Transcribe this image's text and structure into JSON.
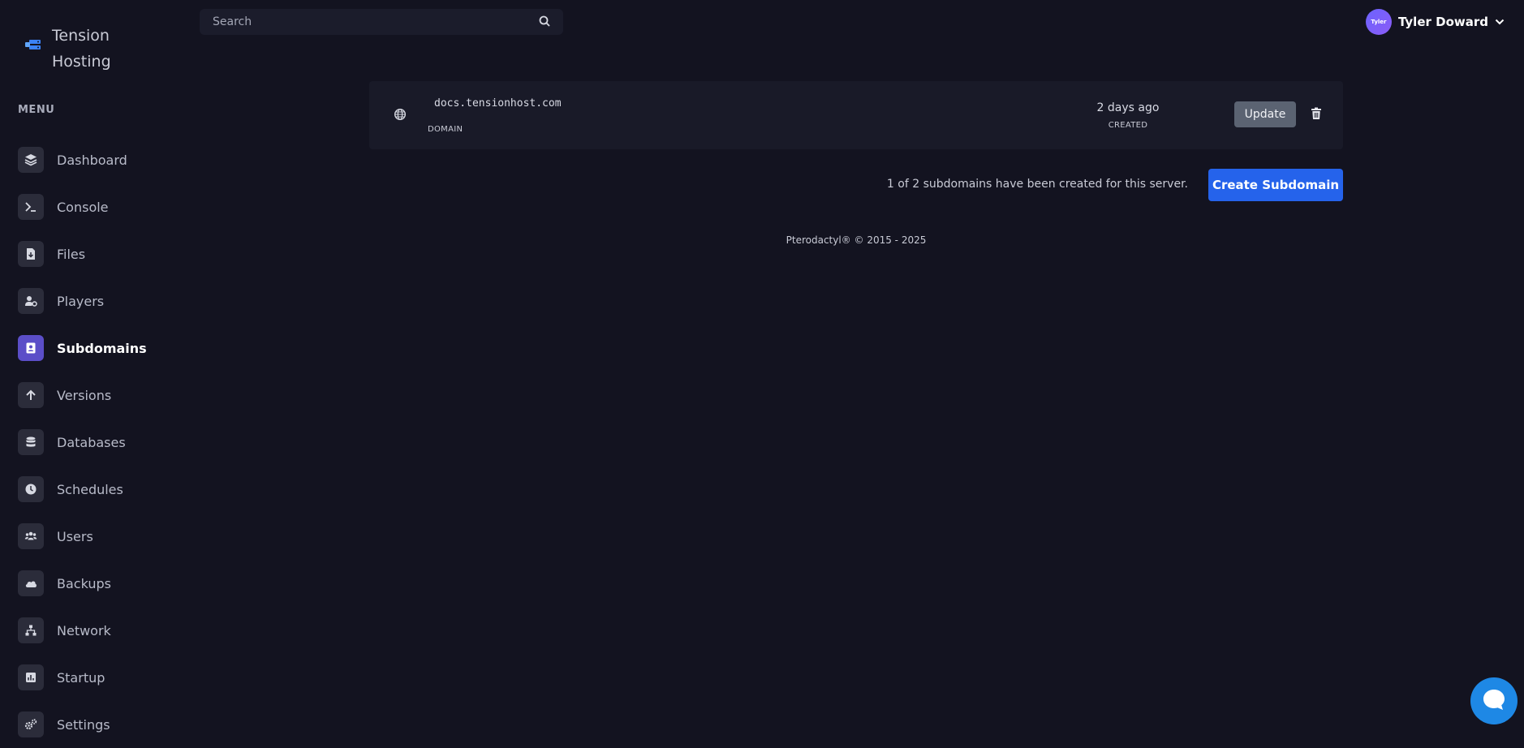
{
  "brand": {
    "name": "Tension Hosting"
  },
  "sidebar": {
    "menu_label": "MENU",
    "items": [
      {
        "label": "Dashboard",
        "icon": "layers-icon",
        "active": false
      },
      {
        "label": "Console",
        "icon": "terminal-icon",
        "active": false
      },
      {
        "label": "Files",
        "icon": "file-download-icon",
        "active": false
      },
      {
        "label": "Players",
        "icon": "user-gear-icon",
        "active": false
      },
      {
        "label": "Subdomains",
        "icon": "address-card-icon",
        "active": true
      },
      {
        "label": "Versions",
        "icon": "arrow-up-icon",
        "active": false
      },
      {
        "label": "Databases",
        "icon": "database-icon",
        "active": false
      },
      {
        "label": "Schedules",
        "icon": "clock-icon",
        "active": false
      },
      {
        "label": "Users",
        "icon": "users-icon",
        "active": false
      },
      {
        "label": "Backups",
        "icon": "cloud-icon",
        "active": false
      },
      {
        "label": "Network",
        "icon": "network-icon",
        "active": false
      },
      {
        "label": "Startup",
        "icon": "chart-icon",
        "active": false
      },
      {
        "label": "Settings",
        "icon": "cogs-icon",
        "active": false
      }
    ]
  },
  "search": {
    "placeholder": "Search"
  },
  "user": {
    "name": "Tyler Doward",
    "avatar_text": "Tyler"
  },
  "subdomains": [
    {
      "domain": "docs.tensionhost.com",
      "domain_label": "DOMAIN",
      "created": "2 days ago",
      "created_label": "CREATED",
      "update_label": "Update"
    }
  ],
  "summary": {
    "text": "1 of 2 subdomains have been created for this server."
  },
  "create_button": {
    "label": "Create Subdomain"
  },
  "footer": {
    "text": "Pterodactyl® © 2015 - 2025"
  },
  "colors": {
    "accent": "#5b4ec8",
    "primary_button": "#2563eb",
    "background": "#131320"
  }
}
